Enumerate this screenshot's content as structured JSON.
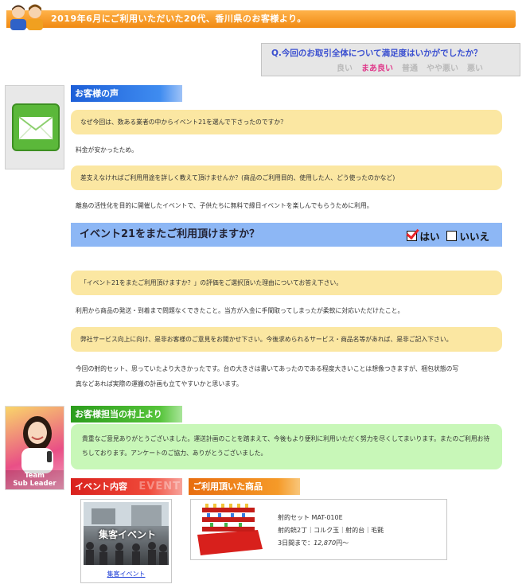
{
  "banner": {
    "title": "2019年6月にご利用いただいた20代、香川県のお客様より。"
  },
  "satisfaction": {
    "question": "Q.今回のお取引全体について満足度はいかがでしたか？",
    "options": [
      "良い",
      "まあ良い",
      "普通",
      "やや悪い",
      "悪い"
    ],
    "selected": "まあ良い"
  },
  "voice": {
    "heading": "お客様の声",
    "q1": "なぜ今回は、数ある業者の中からイベント21を選んで下さったのですか？",
    "a1": "料金が安かったため。",
    "q2": "差支えなければご利用用途を詳しく教えて頂けませんか？(商品のご利用目的、使用した人、どう使ったのかなど)",
    "a2": "離島の活性化を目的に開催したイベントで、子供たちに無料で縁日イベントを楽しんでもらうために利用。",
    "again_question": "イベント21をまたご利用頂けますか？",
    "again_yes": "はい",
    "again_no": "いいえ",
    "q3": "「イベント21をまたご利用頂けますか？」の評価をご選択頂いた理由についてお答え下さい。",
    "a3": "利用から商品の発送・到着まで問題なくできたこと。当方が入金に手間取ってしまったが柔軟に対応いただけたこと。",
    "q4": "弊社サービス向上に向け、是非お客様のご意見をお聞かせ下さい。今後求められるサービス・商品名等があれば、是非ご記入下さい。",
    "a4_line1": "今回の射的セット、思っていたより大きかったです。台の大きさは書いてあったのである程度大きいことは想像つきますが、梱包状態の写",
    "a4_line2": "真などあれば実際の運搬の計画も立てやすいかと思います。"
  },
  "staff": {
    "heading": "お客様担当の村上より",
    "tag_line1": "Team",
    "tag_line2": "Sub Leader",
    "message": "貴重なご意見ありがとうございました。運送計画のことを踏まえて、今後もより便利に利用いただく努力を尽くしてまいります。またのご利用お待ちしております。アンケートのご協力、ありがとうございました。"
  },
  "event": {
    "heading": "イベント内容",
    "ghost": "EVENT",
    "image_text": "集客イベント",
    "link": "集客イベント"
  },
  "goods": {
    "heading": "ご利用頂いた商品",
    "name": "射的セット MAT-010E",
    "items": "射的銃2丁｜コルク玉｜射的台｜毛氈",
    "price_prefix": "3日間まで：",
    "price": "12,870",
    "price_suffix": "円〜"
  },
  "colors": {
    "banner": "#f08a12",
    "accent_pink": "#e0388a",
    "question_bg": "#fbe7a2",
    "staff_bg": "#c8f7b8",
    "again_bg": "#8db7f5"
  }
}
